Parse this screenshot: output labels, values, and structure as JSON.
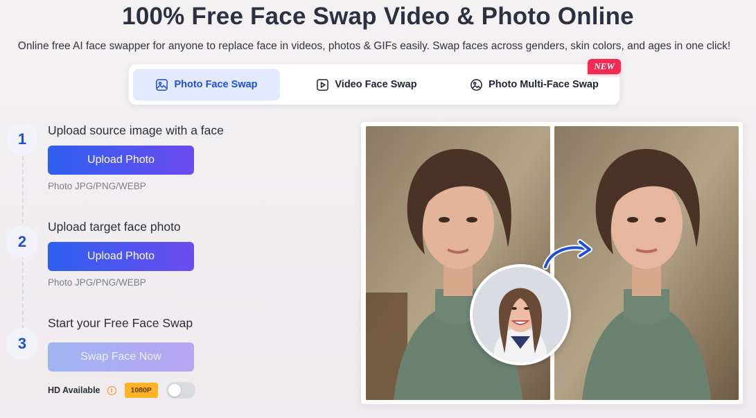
{
  "header": {
    "title": "100% Free Face Swap Video & Photo Online",
    "subtitle": "Online free AI face swapper for anyone to replace face in videos, photos & GIFs easily. Swap faces across genders, skin colors, and ages in one click!"
  },
  "tabs": [
    {
      "label": "Photo Face Swap",
      "icon": "image-icon",
      "active": true
    },
    {
      "label": "Video Face Swap",
      "icon": "video-play-icon",
      "active": false
    },
    {
      "label": "Photo Multi-Face Swap",
      "icon": "multi-face-icon",
      "active": false,
      "badge": "NEW"
    }
  ],
  "steps": [
    {
      "number": "1",
      "label": "Upload source image with a face",
      "button": "Upload Photo",
      "hint": "Photo JPG/PNG/WEBP"
    },
    {
      "number": "2",
      "label": "Upload target face photo",
      "button": "Upload Photo",
      "hint": "Photo JPG/PNG/WEBP"
    },
    {
      "number": "3",
      "label": "Start your Free Face Swap",
      "button": "Swap Face Now"
    }
  ],
  "hd": {
    "label": "HD Available",
    "resolution": "1080P",
    "enabled": false
  },
  "colors": {
    "accent": "#1d4fd8",
    "button_start": "#2e5fef",
    "button_end": "#6c4cf0",
    "new_badge": "#f02c54",
    "res_badge": "#ffb327"
  }
}
